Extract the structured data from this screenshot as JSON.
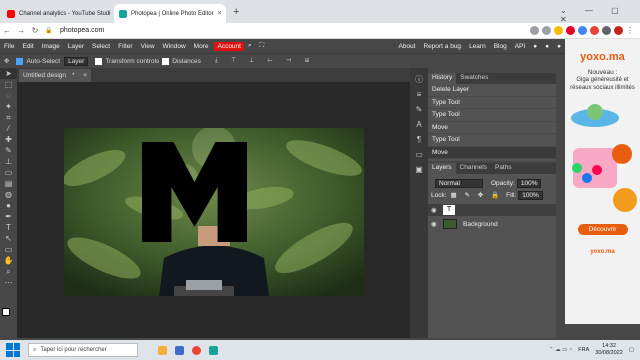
{
  "browser": {
    "tabs": [
      {
        "label": "Channel analytics - YouTube Studi",
        "active": false
      },
      {
        "label": "Photopea | Online Photo Editor",
        "active": true
      }
    ],
    "new_tab": "+",
    "url": "photopea.com"
  },
  "menu": {
    "items": [
      "File",
      "Edit",
      "Image",
      "Layer",
      "Select",
      "Filter",
      "View",
      "Window",
      "More"
    ],
    "account": "Account",
    "right_links": [
      "About",
      "Report a bug",
      "Learn",
      "Blog",
      "API"
    ]
  },
  "options": {
    "auto_select": "Auto-Select",
    "auto_select_value": "Layer",
    "transform_controls": "Transform controls",
    "distances": "Distances"
  },
  "document": {
    "tab_label": "Untitled design",
    "modified": "*",
    "close": "×"
  },
  "history": {
    "tabs": [
      "History",
      "Swatches"
    ],
    "rows": [
      "Delete Layer",
      "Type Tool",
      "Type Tool",
      "Move",
      "Type Tool",
      "Move"
    ]
  },
  "layers": {
    "tabs": [
      "Layers",
      "Channels",
      "Paths"
    ],
    "blend_mode": "Normal",
    "opacity_label": "Opacity:",
    "opacity_value": "100%",
    "lock_label": "Lock:",
    "fill_label": "Fill:",
    "fill_value": "100%",
    "items": [
      {
        "name": "",
        "type": "text"
      },
      {
        "name": "Background",
        "type": "image"
      }
    ]
  },
  "ad": {
    "brand": "yoxo.ma",
    "headline_1": "Nouveau :",
    "headline_2": "Giga généreusité et réseaux sociaux illimités",
    "price": "99",
    "cta": "Découvrir",
    "footer_brand": "yoxo.ma"
  },
  "taskbar": {
    "search_placeholder": "Taper ici pour rechercher",
    "lang": "FRA",
    "time": "14:32",
    "date": "30/08/2022"
  },
  "colors": {
    "account_bg": "#dd1111",
    "panel_bg": "#535353",
    "workspace_bg": "#282828",
    "ad_brand": "#e95d0f"
  },
  "canvas_overlay_text": "M"
}
